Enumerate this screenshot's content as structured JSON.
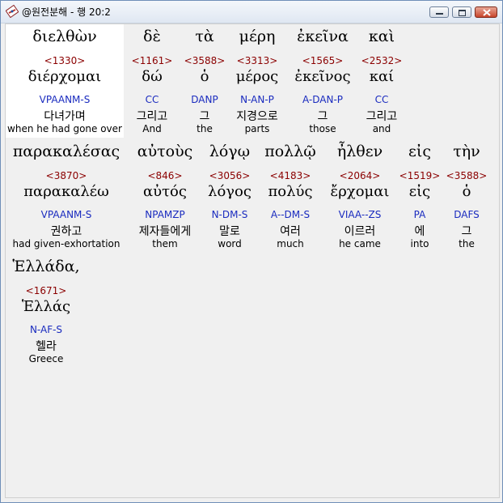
{
  "window": {
    "title": "@원전분해 - 행 20:2",
    "icon": "bible-app-icon",
    "controls": [
      "minimize",
      "maximize",
      "close"
    ]
  },
  "colors": {
    "strong": "#8b0000",
    "morph": "#1a2bbf",
    "highlight": "#ffffff"
  },
  "words": [
    {
      "greek": "διελθὼν",
      "strong": "<1330>",
      "lemma": "διέρχομαι",
      "morph": "VPAANM-S",
      "korean": "다녀가며",
      "english": "when he had gone over",
      "selected": true
    },
    {
      "greek": "δὲ",
      "strong": "<1161>",
      "lemma": "δώ",
      "morph": "CC",
      "korean": "그리고",
      "english": "And"
    },
    {
      "greek": "τὰ",
      "strong": "<3588>",
      "lemma": "ὁ",
      "morph": "DANP",
      "korean": "그",
      "english": "the"
    },
    {
      "greek": "μέρη",
      "strong": "<3313>",
      "lemma": "μέρος",
      "morph": "N-AN-P",
      "korean": "지경으로",
      "english": "parts"
    },
    {
      "greek": "ἐκεῖνα",
      "strong": "<1565>",
      "lemma": "ἐκεῖνος",
      "morph": "A-DAN-P",
      "korean": "그",
      "english": "those"
    },
    {
      "greek": "καὶ",
      "strong": "<2532>",
      "lemma": "καί",
      "morph": "CC",
      "korean": "그리고",
      "english": "and"
    },
    {
      "greek": "παρακαλέσας",
      "strong": "<3870>",
      "lemma": "παρακαλέω",
      "morph": "VPAANM-S",
      "korean": "권하고",
      "english": "had given-exhortation"
    },
    {
      "greek": "αὐτοὺς",
      "strong": "<846>",
      "lemma": "αὐτός",
      "morph": "NPAMZP",
      "korean": "제자들에게",
      "english": "them"
    },
    {
      "greek": "λόγῳ",
      "strong": "<3056>",
      "lemma": "λόγος",
      "morph": "N-DM-S",
      "korean": "말로",
      "english": "word"
    },
    {
      "greek": "πολλῷ",
      "strong": "<4183>",
      "lemma": "πολύς",
      "morph": "A--DM-S",
      "korean": "여러",
      "english": "much"
    },
    {
      "greek": "ἦλθεν",
      "strong": "<2064>",
      "lemma": "ἔρχομαι",
      "morph": "VIAA--ZS",
      "korean": "이르러",
      "english": "he came"
    },
    {
      "greek": "εἰς",
      "strong": "<1519>",
      "lemma": "εἰς",
      "morph": "PA",
      "korean": "에",
      "english": "into"
    },
    {
      "greek": "τὴν",
      "strong": "<3588>",
      "lemma": "ὁ",
      "morph": "DAFS",
      "korean": "그",
      "english": "the"
    },
    {
      "greek": "Ἑλλάδα,",
      "strong": "<1671>",
      "lemma": "Ἑλλάς",
      "morph": "N-AF-S",
      "korean": "헬라",
      "english": "Greece"
    }
  ]
}
